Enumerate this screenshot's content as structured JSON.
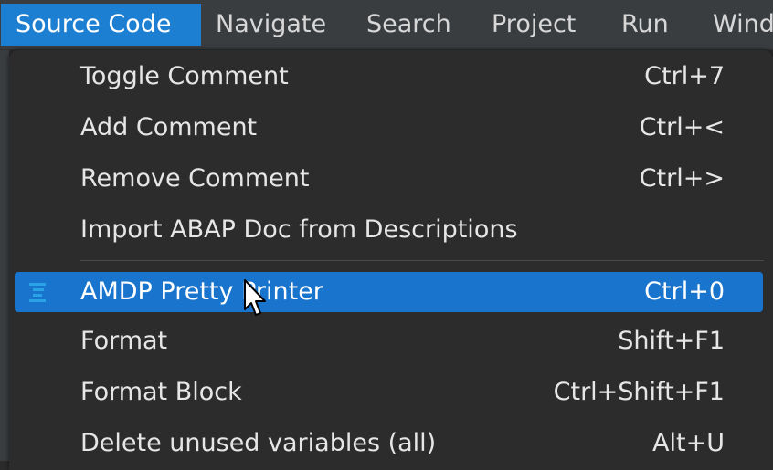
{
  "menubar": {
    "items": [
      {
        "label": "Source Code",
        "active": true
      },
      {
        "label": "Navigate",
        "active": false
      },
      {
        "label": "Search",
        "active": false
      },
      {
        "label": "Project",
        "active": false
      },
      {
        "label": "Run",
        "active": false
      },
      {
        "label": "Wind",
        "active": false
      }
    ]
  },
  "menu": {
    "items": [
      {
        "label": "Toggle Comment",
        "shortcut": "Ctrl+7"
      },
      {
        "label": "Add Comment",
        "shortcut": "Ctrl+<"
      },
      {
        "label": "Remove Comment",
        "shortcut": "Ctrl+>"
      },
      {
        "label": "Import ABAP Doc from Descriptions",
        "shortcut": ""
      },
      {
        "label": "AMDP Pretty Printer",
        "shortcut": "Ctrl+0",
        "selected": true,
        "icon": "pretty-printer-icon"
      },
      {
        "label": "Format",
        "shortcut": "Shift+F1"
      },
      {
        "label": "Format Block",
        "shortcut": "Ctrl+Shift+F1"
      },
      {
        "label": "Delete unused variables (all)",
        "shortcut": "Alt+U"
      }
    ]
  },
  "colors": {
    "menubar_bg": "#3a3d40",
    "active_menu": "#1c7fd1",
    "dropdown_bg": "#2c2c2c",
    "selection": "#1874cd",
    "icon_accent": "#2aa3e6"
  }
}
